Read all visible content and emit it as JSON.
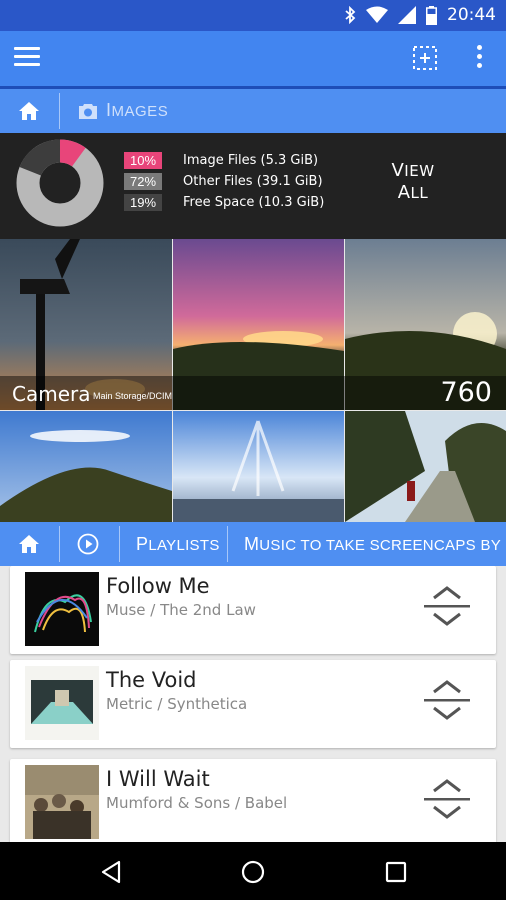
{
  "status_bar": {
    "time": "20:44",
    "icons": [
      "bluetooth-icon",
      "wifi-icon",
      "signal-icon",
      "battery-icon"
    ]
  },
  "app_bar": {
    "icons": [
      "menu-icon",
      "select-add-icon",
      "overflow-icon"
    ]
  },
  "images_breadcrumb": {
    "first_letter": "I",
    "rest": "MAGES"
  },
  "storage": {
    "legend": [
      {
        "pct": "10%",
        "label": "Image Files (5.3 GiB)",
        "color": "#e8457a"
      },
      {
        "pct": "72%",
        "label": "Other Files (39.1 GiB)",
        "color": "#7a7a7a"
      },
      {
        "pct": "19%",
        "label": "Free Space (10.3 GiB)",
        "color": "#444444"
      }
    ],
    "view_all": {
      "line1_first": "V",
      "line1_rest": "IEW",
      "line2_first": "A",
      "line2_rest": "LL"
    }
  },
  "gallery": {
    "album": "Camera",
    "path": "Main Storage/DCIM",
    "count": "760"
  },
  "music_breadcrumb": {
    "playlists_first": "P",
    "playlists_rest": "LAYLISTS",
    "crumb_first": "M",
    "crumb_rest": "USIC TO TAKE SCREENCAPS BY"
  },
  "songs": [
    {
      "title": "Follow Me",
      "subtitle": "Muse / The 2nd Law"
    },
    {
      "title": "The Void",
      "subtitle": "Metric / Synthetica"
    },
    {
      "title": "I Will Wait",
      "subtitle": "Mumford & Sons / Babel"
    }
  ],
  "colors": {
    "accent": "#4285f0",
    "image_files": "#e8457a"
  }
}
